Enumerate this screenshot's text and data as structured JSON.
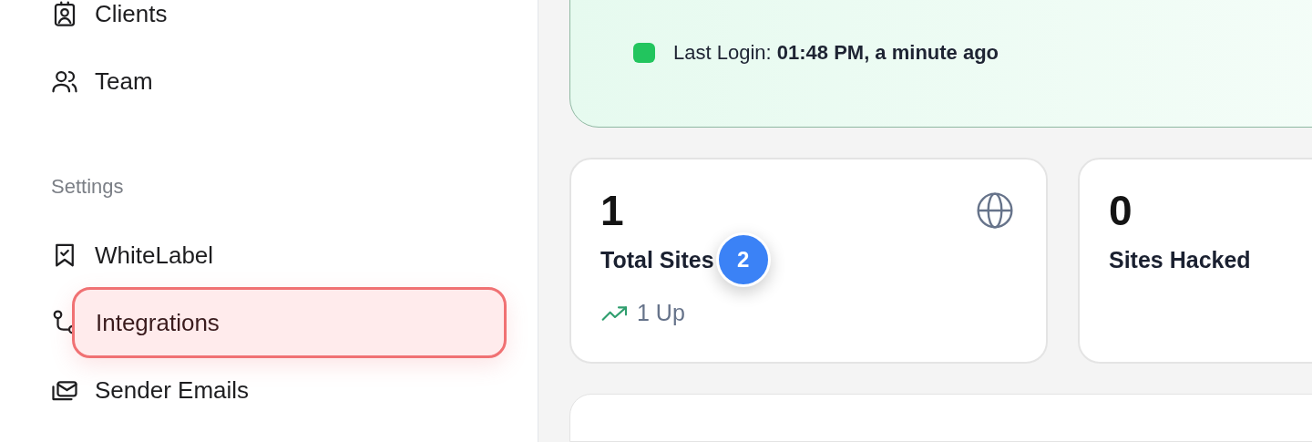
{
  "sidebar": {
    "nav_items": [
      {
        "label": "Clients",
        "selected": false
      },
      {
        "label": "Team",
        "selected": false
      }
    ],
    "section_title": "Settings",
    "settings_items": [
      {
        "label": "WhiteLabel",
        "selected": false
      },
      {
        "label": "Integrations",
        "selected": true
      },
      {
        "label": "Sender Emails",
        "selected": false
      }
    ]
  },
  "login_banner": {
    "text": "Last Login: **01:48 PM, a minute ago**"
  },
  "stats": [
    {
      "value": "1",
      "label": "Total Sites",
      "badge": "2",
      "trend": "1 Up"
    },
    {
      "value": "0",
      "label": "Sites Hacked"
    }
  ]
}
